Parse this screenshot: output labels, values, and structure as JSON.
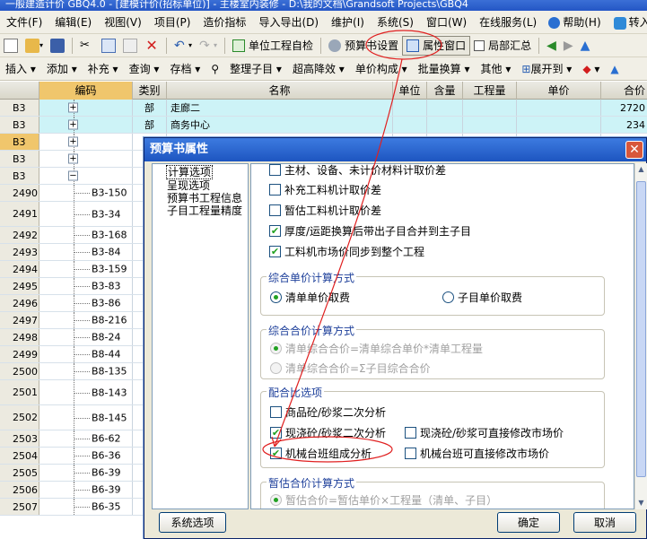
{
  "window": {
    "title": "一般建造计价 GBQ4.0 - [建模计价(招标单位)] - 主楼室内装修 - D:\\我的文档\\Grandsoft Projects\\GBQ4"
  },
  "menu": [
    "文件(F)",
    "编辑(E)",
    "视图(V)",
    "项目(P)",
    "造价指标",
    "导入导出(D)",
    "维护(I)",
    "系统(S)",
    "窗口(W)",
    "在线服务(L)",
    "帮助(H)",
    "转入审核"
  ],
  "toolbar1": {
    "unit_check": "单位工程自检",
    "budget_settings": "预算书设置",
    "attribute_window": "属性窗口",
    "partial_summary": "局部汇总"
  },
  "toolbar2": [
    "插入",
    "添加",
    "补充",
    "查询",
    "存档",
    "整理子目",
    "超高降效",
    "单价构成",
    "批量换算",
    "其他",
    "展开到"
  ],
  "grid": {
    "headers": {
      "code": "编码",
      "type": "类别",
      "name": "名称",
      "unit": "单位",
      "content": "含量",
      "quantity": "工程量",
      "unit_price": "单价",
      "total": "合价"
    },
    "rows": [
      {
        "rn": "B3",
        "pm": "+",
        "type": "部",
        "name": "走廊二",
        "total": "2720"
      },
      {
        "rn": "B3",
        "pm": "+",
        "type": "部",
        "name": "商务中心",
        "total": "234"
      },
      {
        "rn": "B3",
        "pm": "+"
      },
      {
        "rn": "B3",
        "pm": "+"
      },
      {
        "rn": "B3",
        "pm": "−"
      },
      {
        "rn": "2490",
        "code": "B3-150"
      },
      {
        "rn": "2491",
        "code": "B3-34"
      },
      {
        "rn": "2492",
        "code": "B3-168"
      },
      {
        "rn": "2493",
        "code": "B3-84"
      },
      {
        "rn": "2494",
        "code": "B3-159"
      },
      {
        "rn": "2495",
        "code": "B3-83"
      },
      {
        "rn": "2496",
        "code": "B3-86"
      },
      {
        "rn": "2497",
        "code": "B8-216"
      },
      {
        "rn": "2498",
        "code": "B8-24"
      },
      {
        "rn": "2499",
        "code": "B8-44"
      },
      {
        "rn": "2500",
        "code": "B8-135"
      },
      {
        "rn": "2501",
        "code": "B8-143"
      },
      {
        "rn": "2502",
        "code": "B8-145"
      },
      {
        "rn": "2503",
        "code": "B6-62"
      },
      {
        "rn": "2504",
        "code": "B6-36"
      },
      {
        "rn": "2505",
        "code": "B6-39"
      },
      {
        "rn": "2506",
        "code": "B6-39"
      },
      {
        "rn": "2507",
        "code": "B6-35"
      }
    ]
  },
  "dialog": {
    "title": "预算书属性",
    "close": "✕",
    "nav": [
      "计算选项",
      "呈现选项",
      "预算书工程信息",
      "子目工程量精度"
    ],
    "top_options": [
      {
        "label": "主材、设备、未计价材料计取价差",
        "checked": false
      },
      {
        "label": "补充工料机计取价差",
        "checked": false
      },
      {
        "label": "暂估工料机计取价差",
        "checked": false
      },
      {
        "label": "厚度/运距换算后带出子目合并到主子目",
        "checked": true
      },
      {
        "label": "工料机市场价同步到整个工程",
        "checked": true
      }
    ],
    "group_unit_price": {
      "title": "综合单价计算方式",
      "opt1": "清单单价取费",
      "opt2": "子目单价取费"
    },
    "group_total": {
      "title": "综合合价计算方式",
      "opt1": "清单综合合价=清单综合单价*清单工程量",
      "opt2": "清单综合合价=Σ子目综合合价"
    },
    "group_mix": {
      "title": "配合比选项",
      "o1": "商品砼/砂浆二次分析",
      "o2": "现浇砼/砂浆二次分析",
      "o3": "现浇砼/砂浆可直接修改市场价",
      "o4": "机械台班组成分析",
      "o5": "机械台班可直接修改市场价"
    },
    "group_est": {
      "title": "暂估合价计算方式",
      "opt1": "暂估合价=暂估单价×工程量（清单、子目）"
    },
    "buttons": {
      "system": "系统选项",
      "ok": "确定",
      "cancel": "取消"
    }
  }
}
